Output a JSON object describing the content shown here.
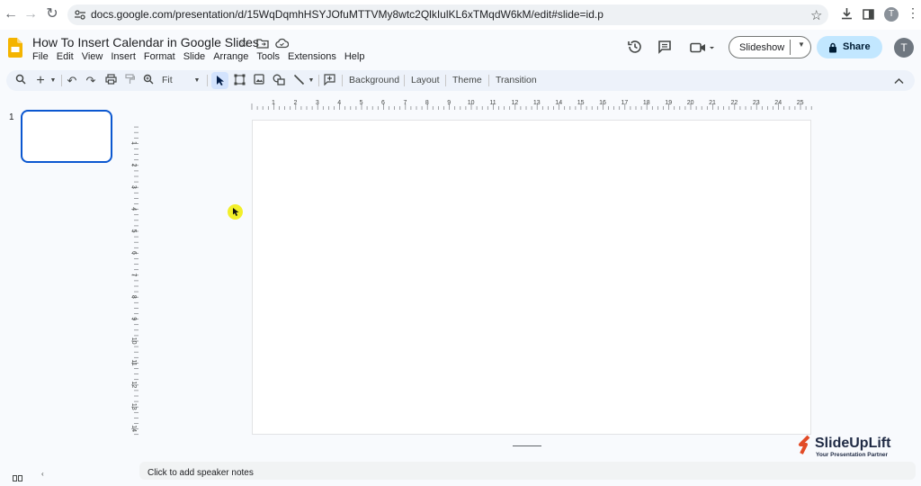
{
  "browser": {
    "url": "docs.google.com/presentation/d/15WqDqmhHSYJOfuMTTVMy8wtc2QlkIulKL6xTMqdW6kM/edit#slide=id.p",
    "profile_initial": "T"
  },
  "app": {
    "title": "How To Insert Calendar in Google Slides",
    "menu": [
      "File",
      "Edit",
      "View",
      "Insert",
      "Format",
      "Slide",
      "Arrange",
      "Tools",
      "Extensions",
      "Help"
    ],
    "slideshow_label": "Slideshow",
    "share_label": "Share",
    "user_initial": "T",
    "accent": "#0b57d0",
    "share_bg": "#c2e7ff"
  },
  "toolbar": {
    "zoom": "Fit",
    "background_label": "Background",
    "layout_label": "Layout",
    "theme_label": "Theme",
    "transition_label": "Transition"
  },
  "filmstrip": {
    "slide_number": "1"
  },
  "rulers": {
    "horizontal": [
      "1",
      "2",
      "3",
      "4",
      "5",
      "6",
      "7",
      "8",
      "9",
      "10",
      "11",
      "12",
      "13",
      "14",
      "15",
      "16",
      "17",
      "18",
      "19",
      "20",
      "21",
      "22",
      "23",
      "24",
      "25"
    ],
    "vertical": [
      "1",
      "2",
      "3",
      "4",
      "5",
      "6",
      "7",
      "8",
      "9",
      "10",
      "11",
      "12",
      "13",
      "14"
    ]
  },
  "notes": {
    "placeholder": "Click to add speaker notes"
  },
  "watermark": {
    "brand": "SlideUpLift",
    "tagline": "Your Presentation Partner"
  }
}
